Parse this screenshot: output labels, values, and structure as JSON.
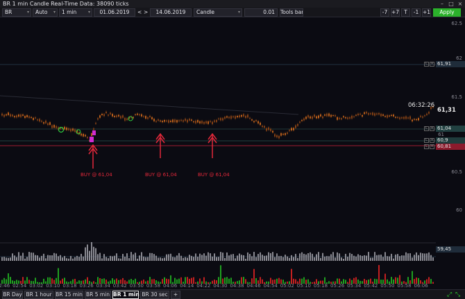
{
  "window": {
    "title": "BR 1 min Candle Real-Time Data: 38090 ticks",
    "controls": [
      "–",
      "□",
      "×"
    ]
  },
  "toolbar": {
    "symbol": "BR",
    "mode": "Auto",
    "interval": "1 min",
    "date_from": "01.06.2019",
    "nav_prev": "<",
    "nav_next": ">",
    "date_to": "14.06.2019",
    "chart_type": "Candle",
    "step": "0.01",
    "tools_bar": "Tools bar",
    "buttons": [
      "-7",
      "+7",
      "T",
      "-1",
      "+1"
    ],
    "apply": "Apply"
  },
  "chart": {
    "y_labels": [
      "62.5",
      "62",
      "61.5",
      "61",
      "60.5",
      "60"
    ],
    "price_tags": [
      {
        "value": "61,91",
        "color": "#1f2c3a"
      },
      {
        "value": "61,04",
        "color": "#214141"
      },
      {
        "value": "60,9",
        "color": "#1f3c3c"
      },
      {
        "value": "60,81",
        "color": "#8b1a2c"
      }
    ],
    "last_price": "61,31",
    "clock": "06:32:26",
    "volume_tag": "59,45",
    "lx_label": "L",
    "x_labels": [
      "02:46",
      "02:54",
      "03:02",
      "03:10",
      "03:18",
      "03:26",
      "03:34",
      "03:42",
      "03:50",
      "03:58",
      "04:06",
      "04:14",
      "04:22",
      "04:30",
      "04:38",
      "04:46",
      "04:54",
      "05:02",
      "05:10",
      "05:18",
      "05:26",
      "05:34",
      "05:42",
      "05:50",
      "05:58",
      "06:06"
    ],
    "signals": [
      {
        "label": "BUY @ 61,04"
      },
      {
        "label": "BUY @ 61,04"
      },
      {
        "label": "BUY @ 61,04"
      }
    ]
  },
  "tabs": [
    {
      "label": "BR Day",
      "active": false
    },
    {
      "label": "BR 1 hour",
      "active": false
    },
    {
      "label": "BR 15 min",
      "active": false
    },
    {
      "label": "BR 5 min",
      "active": false
    },
    {
      "label": "BR 1 min",
      "active": true
    },
    {
      "label": "BR 30 sec",
      "active": false
    },
    {
      "label": "+",
      "active": false
    }
  ],
  "colors": {
    "apply": "#2bb12b",
    "buy": "#e3283a",
    "candle": "#c8651b",
    "background": "#0b0b12"
  },
  "icons": {
    "expand": "expand-arrows-icon",
    "collapse": "collapse-arrows-icon"
  }
}
